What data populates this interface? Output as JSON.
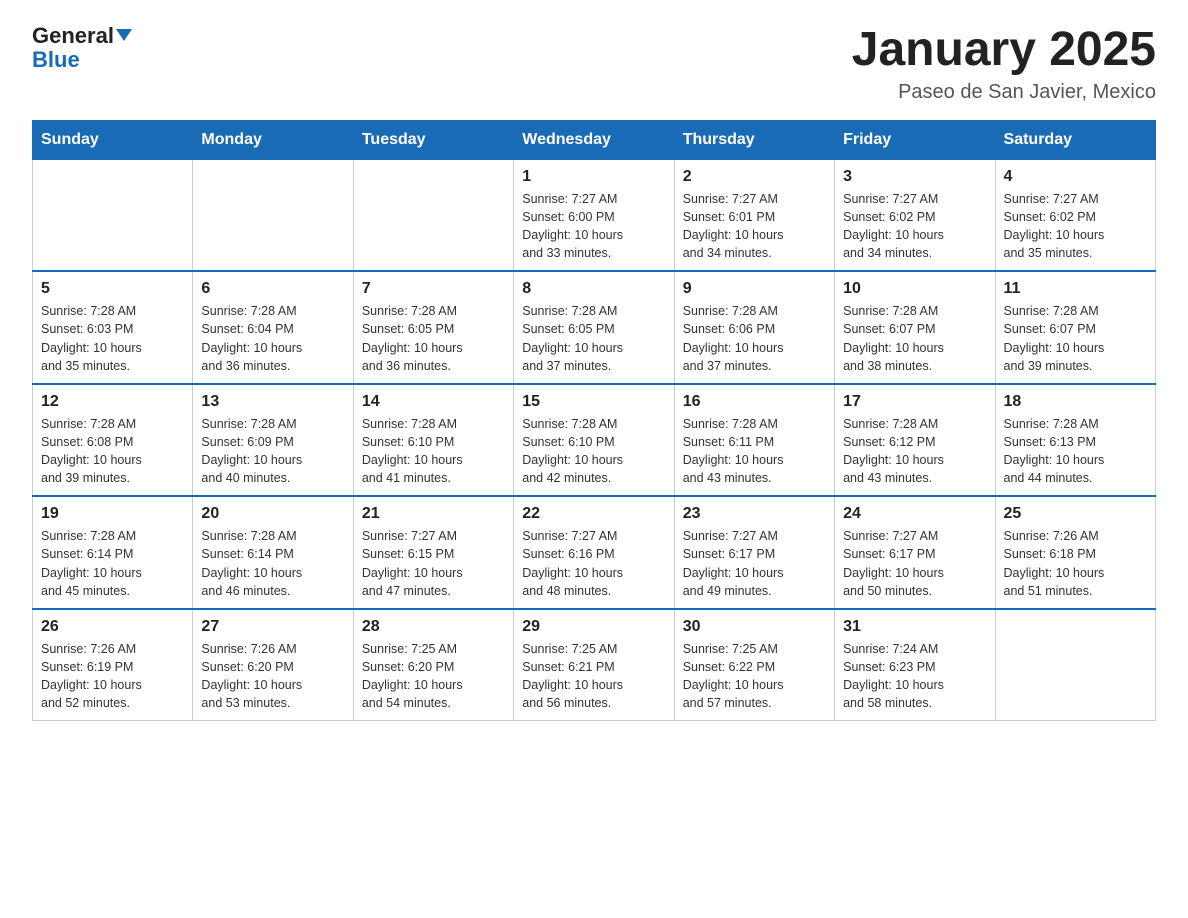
{
  "header": {
    "logo_general": "General",
    "logo_blue": "Blue",
    "month_title": "January 2025",
    "location": "Paseo de San Javier, Mexico"
  },
  "days_of_week": [
    "Sunday",
    "Monday",
    "Tuesday",
    "Wednesday",
    "Thursday",
    "Friday",
    "Saturday"
  ],
  "weeks": [
    [
      {
        "day": "",
        "info": ""
      },
      {
        "day": "",
        "info": ""
      },
      {
        "day": "",
        "info": ""
      },
      {
        "day": "1",
        "info": "Sunrise: 7:27 AM\nSunset: 6:00 PM\nDaylight: 10 hours\nand 33 minutes."
      },
      {
        "day": "2",
        "info": "Sunrise: 7:27 AM\nSunset: 6:01 PM\nDaylight: 10 hours\nand 34 minutes."
      },
      {
        "day": "3",
        "info": "Sunrise: 7:27 AM\nSunset: 6:02 PM\nDaylight: 10 hours\nand 34 minutes."
      },
      {
        "day": "4",
        "info": "Sunrise: 7:27 AM\nSunset: 6:02 PM\nDaylight: 10 hours\nand 35 minutes."
      }
    ],
    [
      {
        "day": "5",
        "info": "Sunrise: 7:28 AM\nSunset: 6:03 PM\nDaylight: 10 hours\nand 35 minutes."
      },
      {
        "day": "6",
        "info": "Sunrise: 7:28 AM\nSunset: 6:04 PM\nDaylight: 10 hours\nand 36 minutes."
      },
      {
        "day": "7",
        "info": "Sunrise: 7:28 AM\nSunset: 6:05 PM\nDaylight: 10 hours\nand 36 minutes."
      },
      {
        "day": "8",
        "info": "Sunrise: 7:28 AM\nSunset: 6:05 PM\nDaylight: 10 hours\nand 37 minutes."
      },
      {
        "day": "9",
        "info": "Sunrise: 7:28 AM\nSunset: 6:06 PM\nDaylight: 10 hours\nand 37 minutes."
      },
      {
        "day": "10",
        "info": "Sunrise: 7:28 AM\nSunset: 6:07 PM\nDaylight: 10 hours\nand 38 minutes."
      },
      {
        "day": "11",
        "info": "Sunrise: 7:28 AM\nSunset: 6:07 PM\nDaylight: 10 hours\nand 39 minutes."
      }
    ],
    [
      {
        "day": "12",
        "info": "Sunrise: 7:28 AM\nSunset: 6:08 PM\nDaylight: 10 hours\nand 39 minutes."
      },
      {
        "day": "13",
        "info": "Sunrise: 7:28 AM\nSunset: 6:09 PM\nDaylight: 10 hours\nand 40 minutes."
      },
      {
        "day": "14",
        "info": "Sunrise: 7:28 AM\nSunset: 6:10 PM\nDaylight: 10 hours\nand 41 minutes."
      },
      {
        "day": "15",
        "info": "Sunrise: 7:28 AM\nSunset: 6:10 PM\nDaylight: 10 hours\nand 42 minutes."
      },
      {
        "day": "16",
        "info": "Sunrise: 7:28 AM\nSunset: 6:11 PM\nDaylight: 10 hours\nand 43 minutes."
      },
      {
        "day": "17",
        "info": "Sunrise: 7:28 AM\nSunset: 6:12 PM\nDaylight: 10 hours\nand 43 minutes."
      },
      {
        "day": "18",
        "info": "Sunrise: 7:28 AM\nSunset: 6:13 PM\nDaylight: 10 hours\nand 44 minutes."
      }
    ],
    [
      {
        "day": "19",
        "info": "Sunrise: 7:28 AM\nSunset: 6:14 PM\nDaylight: 10 hours\nand 45 minutes."
      },
      {
        "day": "20",
        "info": "Sunrise: 7:28 AM\nSunset: 6:14 PM\nDaylight: 10 hours\nand 46 minutes."
      },
      {
        "day": "21",
        "info": "Sunrise: 7:27 AM\nSunset: 6:15 PM\nDaylight: 10 hours\nand 47 minutes."
      },
      {
        "day": "22",
        "info": "Sunrise: 7:27 AM\nSunset: 6:16 PM\nDaylight: 10 hours\nand 48 minutes."
      },
      {
        "day": "23",
        "info": "Sunrise: 7:27 AM\nSunset: 6:17 PM\nDaylight: 10 hours\nand 49 minutes."
      },
      {
        "day": "24",
        "info": "Sunrise: 7:27 AM\nSunset: 6:17 PM\nDaylight: 10 hours\nand 50 minutes."
      },
      {
        "day": "25",
        "info": "Sunrise: 7:26 AM\nSunset: 6:18 PM\nDaylight: 10 hours\nand 51 minutes."
      }
    ],
    [
      {
        "day": "26",
        "info": "Sunrise: 7:26 AM\nSunset: 6:19 PM\nDaylight: 10 hours\nand 52 minutes."
      },
      {
        "day": "27",
        "info": "Sunrise: 7:26 AM\nSunset: 6:20 PM\nDaylight: 10 hours\nand 53 minutes."
      },
      {
        "day": "28",
        "info": "Sunrise: 7:25 AM\nSunset: 6:20 PM\nDaylight: 10 hours\nand 54 minutes."
      },
      {
        "day": "29",
        "info": "Sunrise: 7:25 AM\nSunset: 6:21 PM\nDaylight: 10 hours\nand 56 minutes."
      },
      {
        "day": "30",
        "info": "Sunrise: 7:25 AM\nSunset: 6:22 PM\nDaylight: 10 hours\nand 57 minutes."
      },
      {
        "day": "31",
        "info": "Sunrise: 7:24 AM\nSunset: 6:23 PM\nDaylight: 10 hours\nand 58 minutes."
      },
      {
        "day": "",
        "info": ""
      }
    ]
  ]
}
